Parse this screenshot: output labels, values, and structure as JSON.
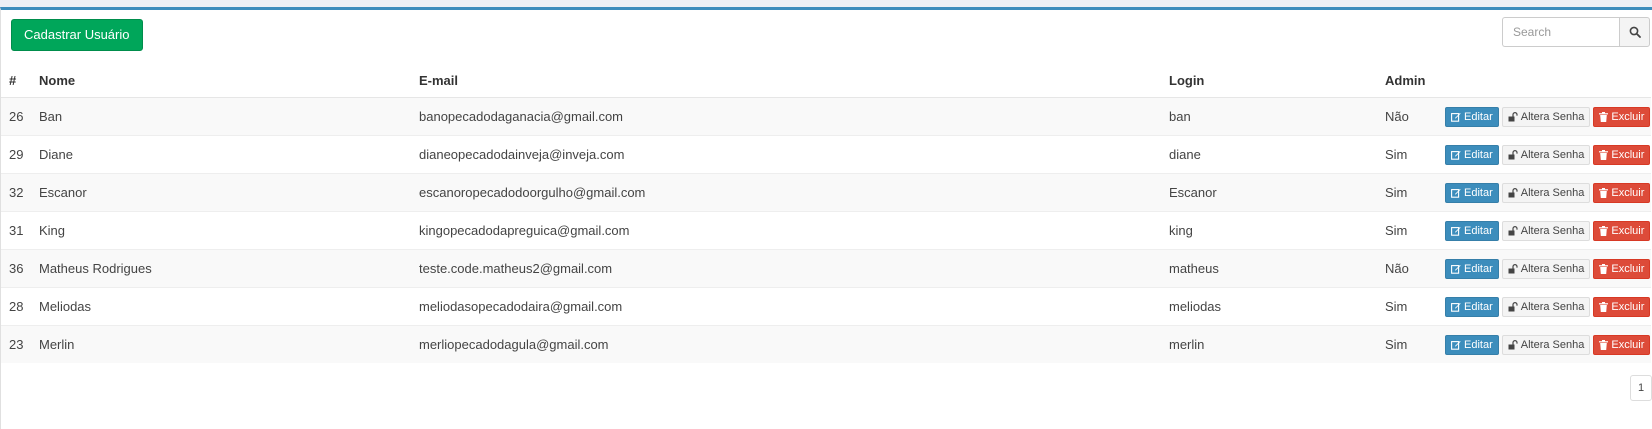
{
  "toolbar": {
    "add_label": "Cadastrar Usuário"
  },
  "search": {
    "placeholder": "Search",
    "value": ""
  },
  "table": {
    "headers": {
      "id": "#",
      "nome": "Nome",
      "email": "E-mail",
      "login": "Login",
      "admin": "Admin"
    },
    "actions": {
      "edit": "Editar",
      "password": "Altera Senha",
      "delete": "Excluir"
    },
    "rows": [
      {
        "id": "26",
        "nome": "Ban",
        "email": "banopecadodaganacia@gmail.com",
        "login": "ban",
        "admin": "Não"
      },
      {
        "id": "29",
        "nome": "Diane",
        "email": "dianeopecadodainveja@inveja.com",
        "login": "diane",
        "admin": "Sim"
      },
      {
        "id": "32",
        "nome": "Escanor",
        "email": "escanoropecadodoorgulho@gmail.com",
        "login": "Escanor",
        "admin": "Sim"
      },
      {
        "id": "31",
        "nome": "King",
        "email": "kingopecadodapreguica@gmail.com",
        "login": "king",
        "admin": "Sim"
      },
      {
        "id": "36",
        "nome": "Matheus Rodrigues",
        "email": "teste.code.matheus2@gmail.com",
        "login": "matheus",
        "admin": "Não"
      },
      {
        "id": "28",
        "nome": "Meliodas",
        "email": "meliodasopecadodaira@gmail.com",
        "login": "meliodas",
        "admin": "Sim"
      },
      {
        "id": "23",
        "nome": "Merlin",
        "email": "merliopecadodagula@gmail.com",
        "login": "merlin",
        "admin": "Sim"
      }
    ]
  },
  "pagination": {
    "current_page": "1"
  },
  "colors": {
    "accent": "#3c8dbc",
    "success": "#00a65a",
    "danger": "#dd4b39"
  }
}
